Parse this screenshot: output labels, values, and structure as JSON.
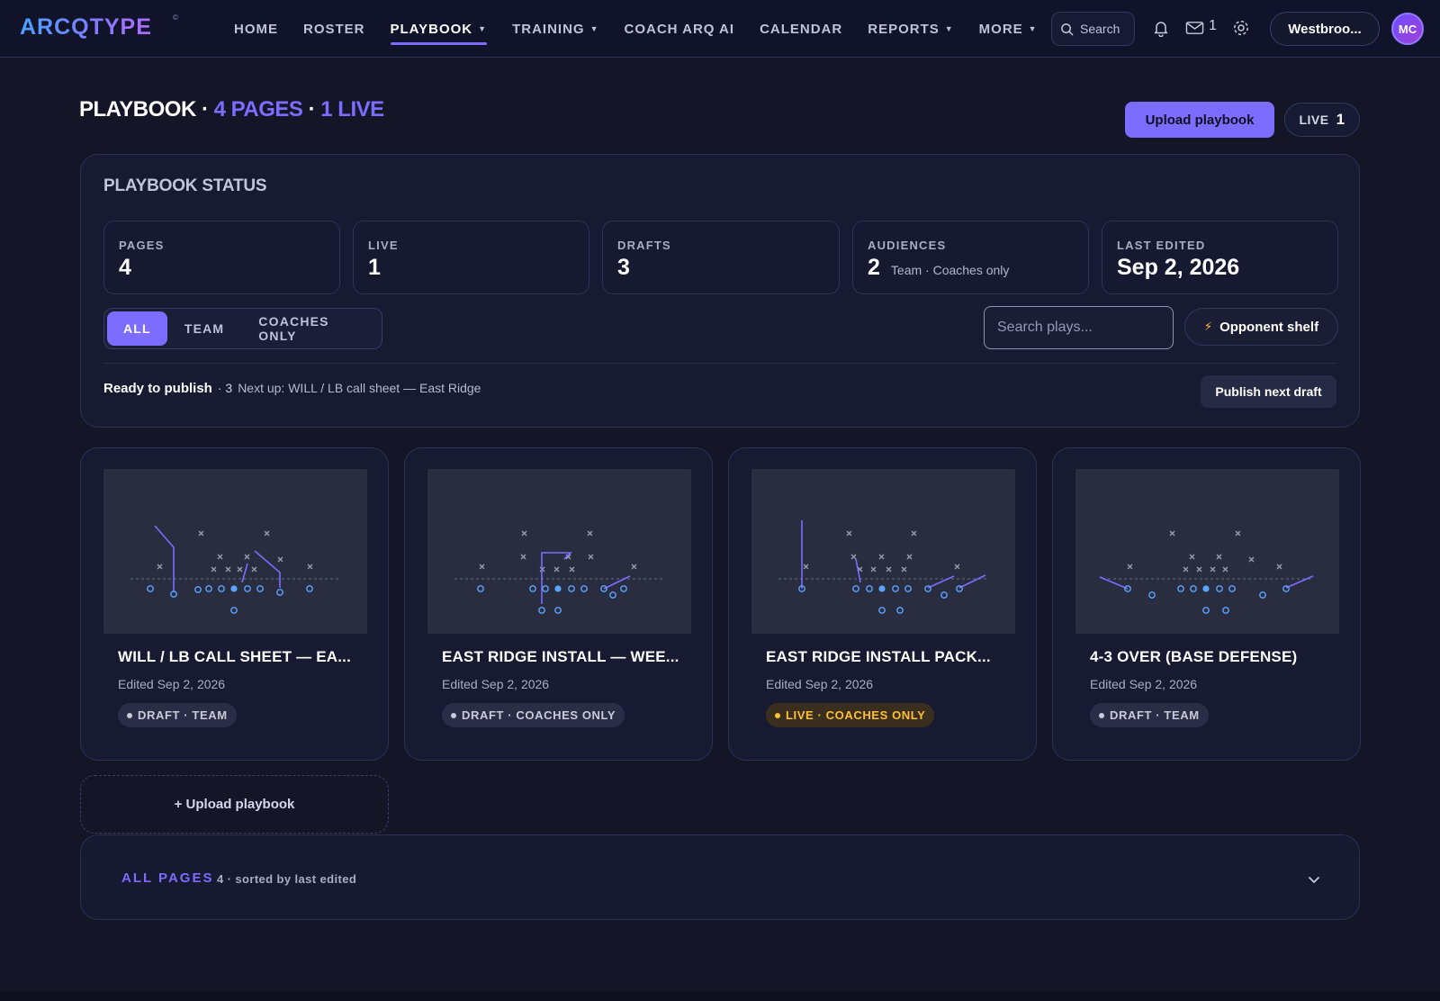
{
  "app": {
    "brand": "ARCQTYPE",
    "brand_mark": "©",
    "colors": {
      "accent": "#7c6cff",
      "live": "#ffbf33",
      "background": "#141628"
    }
  },
  "nav": {
    "items": [
      {
        "label": "HOME",
        "caret": false,
        "active": false
      },
      {
        "label": "ROSTER",
        "caret": false,
        "active": false
      },
      {
        "label": "PLAYBOOK",
        "caret": true,
        "active": true
      },
      {
        "label": "TRAINING",
        "caret": true,
        "active": false
      },
      {
        "label": "COACH ARQ AI",
        "caret": false,
        "active": false
      },
      {
        "label": "CALENDAR",
        "caret": false,
        "active": false
      },
      {
        "label": "REPORTS",
        "caret": true,
        "active": false
      },
      {
        "label": "MORE",
        "caret": true,
        "active": false
      }
    ],
    "search_label": "Search",
    "mail_count": "1",
    "team_name": "Westbroo...",
    "avatar_initials": "MC",
    "icons": [
      "search-icon",
      "bell-icon",
      "mail-icon",
      "gear-icon"
    ]
  },
  "header": {
    "title": "PLAYBOOK",
    "sep1": "·",
    "pages_text": "4 PAGES",
    "sep2": "·",
    "live_text": "1 LIVE",
    "upload_label": "Upload playbook",
    "live_pill_label": "LIVE",
    "live_pill_count": "1"
  },
  "status": {
    "title": "PLAYBOOK STATUS",
    "stats": [
      {
        "label": "PAGES",
        "value": "4",
        "sub": ""
      },
      {
        "label": "LIVE",
        "value": "1",
        "sub": ""
      },
      {
        "label": "DRAFTS",
        "value": "3",
        "sub": ""
      },
      {
        "label": "AUDIENCES",
        "value": "2",
        "sub": "Team · Coaches only"
      },
      {
        "label": "LAST EDITED",
        "value": "Sep 2, 2026",
        "sub": ""
      }
    ],
    "filters": [
      {
        "label": "ALL",
        "selected": true
      },
      {
        "label": "TEAM",
        "selected": false
      },
      {
        "label": "COACHES ONLY",
        "selected": false
      }
    ],
    "search_placeholder": "Search plays...",
    "opponent_shelf_label": "Opponent shelf",
    "ready_label": "Ready to publish",
    "ready_count": "· 3",
    "next_up": "Next up: WILL / LB call sheet — East Ridge",
    "publish_label": "Publish next draft"
  },
  "cards": [
    {
      "title": "WILL / LB CALL SHEET — EA...",
      "edited": "Edited Sep 2, 2026",
      "badge": "DRAFT · TEAM",
      "live": false
    },
    {
      "title": "EAST RIDGE INSTALL — WEE...",
      "edited": "Edited Sep 2, 2026",
      "badge": "DRAFT · COACHES ONLY",
      "live": false
    },
    {
      "title": "EAST RIDGE INSTALL PACK...",
      "edited": "Edited Sep 2, 2026",
      "badge": "LIVE · COACHES ONLY",
      "live": true
    },
    {
      "title": "4-3 OVER (BASE DEFENSE)",
      "edited": "Edited Sep 2, 2026",
      "badge": "DRAFT · TEAM",
      "live": false
    }
  ],
  "add_card_label": "+ Upload playbook",
  "all_pages": {
    "label": "ALL PAGES",
    "meta": "4 · sorted by last edited"
  }
}
